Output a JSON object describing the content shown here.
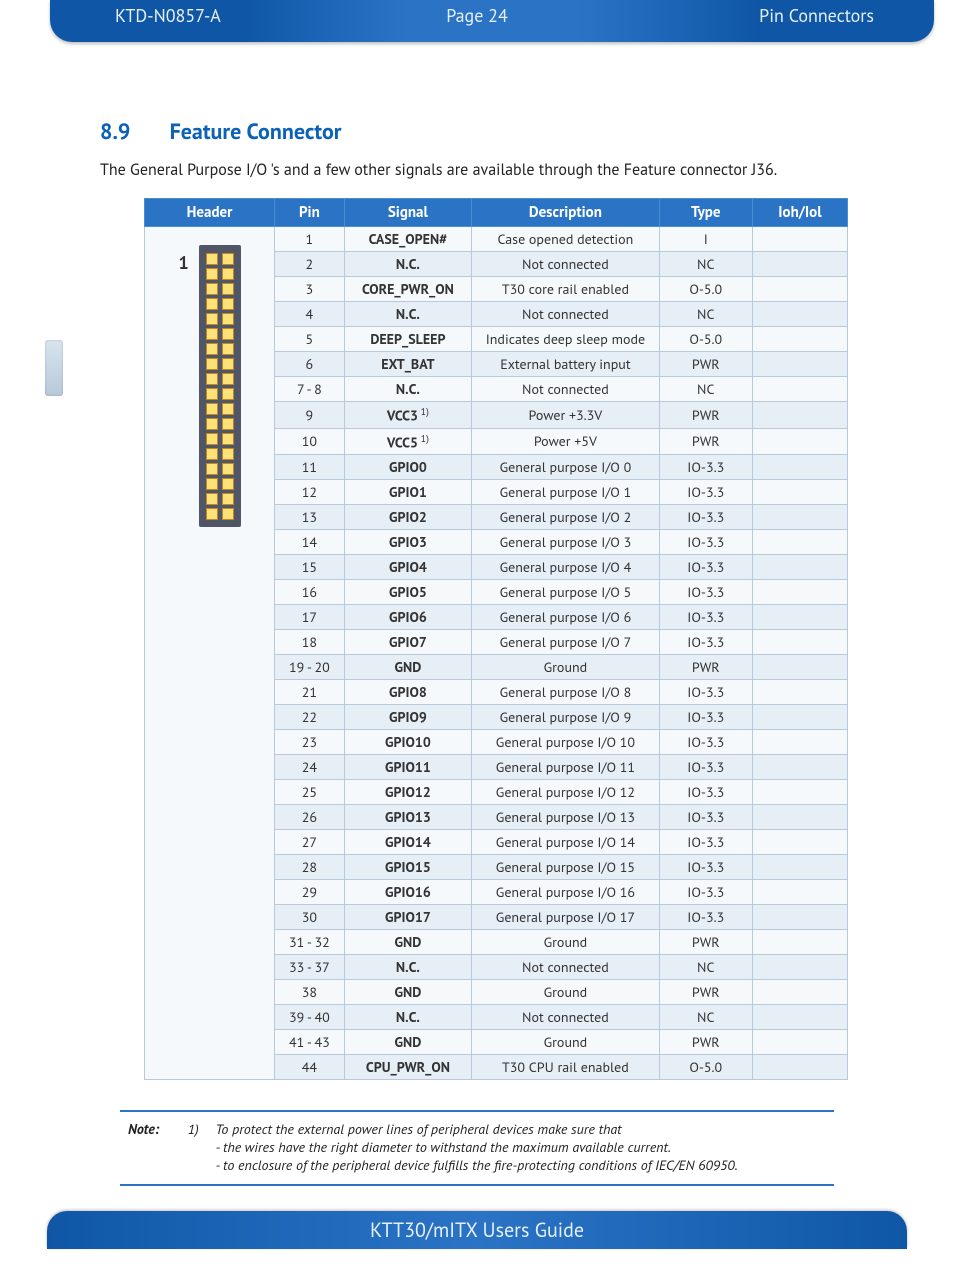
{
  "header": {
    "doc_id": "KTD-N0857-A",
    "page": "Page 24",
    "section": "Pin Connectors"
  },
  "title": {
    "number": "8.9",
    "text": "Feature Connector"
  },
  "intro": "The General Purpose I/O 's and a few other signals are available through the Feature connector J36.",
  "table": {
    "headers": {
      "h0": "Header",
      "h1": "Pin",
      "h2": "Signal",
      "h3": "Description",
      "h4": "Type",
      "h5": "Ioh/Iol"
    },
    "header_label": "1",
    "rows": [
      {
        "pin": "1",
        "sig": "CASE_OPEN#",
        "desc": "Case opened detection",
        "type": "I",
        "io": "",
        "sup": ""
      },
      {
        "pin": "2",
        "sig": "N.C.",
        "desc": "Not connected",
        "type": "NC",
        "io": "",
        "sup": ""
      },
      {
        "pin": "3",
        "sig": "CORE_PWR_ON",
        "desc": "T30 core rail enabled",
        "type": "O-5.0",
        "io": "",
        "sup": ""
      },
      {
        "pin": "4",
        "sig": "N.C.",
        "desc": "Not connected",
        "type": "NC",
        "io": "",
        "sup": ""
      },
      {
        "pin": "5",
        "sig": "DEEP_SLEEP",
        "desc": "Indicates deep sleep mode",
        "type": "O-5.0",
        "io": "",
        "sup": ""
      },
      {
        "pin": "6",
        "sig": "EXT_BAT",
        "desc": "External battery input",
        "type": "PWR",
        "io": "",
        "sup": ""
      },
      {
        "pin": "7 - 8",
        "sig": "N.C.",
        "desc": "Not connected",
        "type": "NC",
        "io": "",
        "sup": ""
      },
      {
        "pin": "9",
        "sig": "VCC3",
        "desc": "Power +3.3V",
        "type": "PWR",
        "io": "",
        "sup": "1)"
      },
      {
        "pin": "10",
        "sig": "VCC5",
        "desc": "Power +5V",
        "type": "PWR",
        "io": "",
        "sup": "1)"
      },
      {
        "pin": "11",
        "sig": "GPIO0",
        "desc": "General purpose I/O 0",
        "type": "IO-3.3",
        "io": "",
        "sup": ""
      },
      {
        "pin": "12",
        "sig": "GPIO1",
        "desc": "General purpose I/O 1",
        "type": "IO-3.3",
        "io": "",
        "sup": ""
      },
      {
        "pin": "13",
        "sig": "GPIO2",
        "desc": "General purpose I/O 2",
        "type": "IO-3.3",
        "io": "",
        "sup": ""
      },
      {
        "pin": "14",
        "sig": "GPIO3",
        "desc": "General purpose I/O 3",
        "type": "IO-3.3",
        "io": "",
        "sup": ""
      },
      {
        "pin": "15",
        "sig": "GPIO4",
        "desc": "General purpose I/O 4",
        "type": "IO-3.3",
        "io": "",
        "sup": ""
      },
      {
        "pin": "16",
        "sig": "GPIO5",
        "desc": "General purpose I/O 5",
        "type": "IO-3.3",
        "io": "",
        "sup": ""
      },
      {
        "pin": "17",
        "sig": "GPIO6",
        "desc": "General purpose I/O 6",
        "type": "IO-3.3",
        "io": "",
        "sup": ""
      },
      {
        "pin": "18",
        "sig": "GPIO7",
        "desc": "General purpose I/O 7",
        "type": "IO-3.3",
        "io": "",
        "sup": ""
      },
      {
        "pin": "19 - 20",
        "sig": "GND",
        "desc": "Ground",
        "type": "PWR",
        "io": "",
        "sup": ""
      },
      {
        "pin": "21",
        "sig": "GPIO8",
        "desc": "General purpose I/O 8",
        "type": "IO-3.3",
        "io": "",
        "sup": ""
      },
      {
        "pin": "22",
        "sig": "GPIO9",
        "desc": "General purpose I/O 9",
        "type": "IO-3.3",
        "io": "",
        "sup": ""
      },
      {
        "pin": "23",
        "sig": "GPIO10",
        "desc": "General purpose I/O 10",
        "type": "IO-3.3",
        "io": "",
        "sup": ""
      },
      {
        "pin": "24",
        "sig": "GPIO11",
        "desc": "General purpose I/O 11",
        "type": "IO-3.3",
        "io": "",
        "sup": ""
      },
      {
        "pin": "25",
        "sig": "GPIO12",
        "desc": "General purpose I/O 12",
        "type": "IO-3.3",
        "io": "",
        "sup": ""
      },
      {
        "pin": "26",
        "sig": "GPIO13",
        "desc": "General purpose I/O 13",
        "type": "IO-3.3",
        "io": "",
        "sup": ""
      },
      {
        "pin": "27",
        "sig": "GPIO14",
        "desc": "General purpose I/O 14",
        "type": "IO-3.3",
        "io": "",
        "sup": ""
      },
      {
        "pin": "28",
        "sig": "GPIO15",
        "desc": "General purpose I/O 15",
        "type": "IO-3.3",
        "io": "",
        "sup": ""
      },
      {
        "pin": "29",
        "sig": "GPIO16",
        "desc": "General purpose I/O 16",
        "type": "IO-3.3",
        "io": "",
        "sup": ""
      },
      {
        "pin": "30",
        "sig": "GPIO17",
        "desc": "General purpose I/O 17",
        "type": "IO-3.3",
        "io": "",
        "sup": ""
      },
      {
        "pin": "31 - 32",
        "sig": "GND",
        "desc": "Ground",
        "type": "PWR",
        "io": "",
        "sup": ""
      },
      {
        "pin": "33 - 37",
        "sig": "N.C.",
        "desc": "Not connected",
        "type": "NC",
        "io": "",
        "sup": ""
      },
      {
        "pin": "38",
        "sig": "GND",
        "desc": "Ground",
        "type": "PWR",
        "io": "",
        "sup": ""
      },
      {
        "pin": "39 - 40",
        "sig": "N.C.",
        "desc": "Not connected",
        "type": "NC",
        "io": "",
        "sup": ""
      },
      {
        "pin": "41 - 43",
        "sig": "GND",
        "desc": "Ground",
        "type": "PWR",
        "io": "",
        "sup": ""
      },
      {
        "pin": "44",
        "sig": "CPU_PWR_ON",
        "desc": "T30 CPU rail enabled",
        "type": "O-5.0",
        "io": "",
        "sup": ""
      }
    ]
  },
  "note": {
    "label": "Note:",
    "index": "1)",
    "line1": "To protect the external power lines of peripheral devices make sure that",
    "line2": "- the wires have the right diameter to withstand the maximum available current.",
    "line3": "- to enclosure of the peripheral device fulfills the fire-protecting conditions of IEC/EN 60950."
  },
  "footer": "KTT30/mITX Users Guide"
}
